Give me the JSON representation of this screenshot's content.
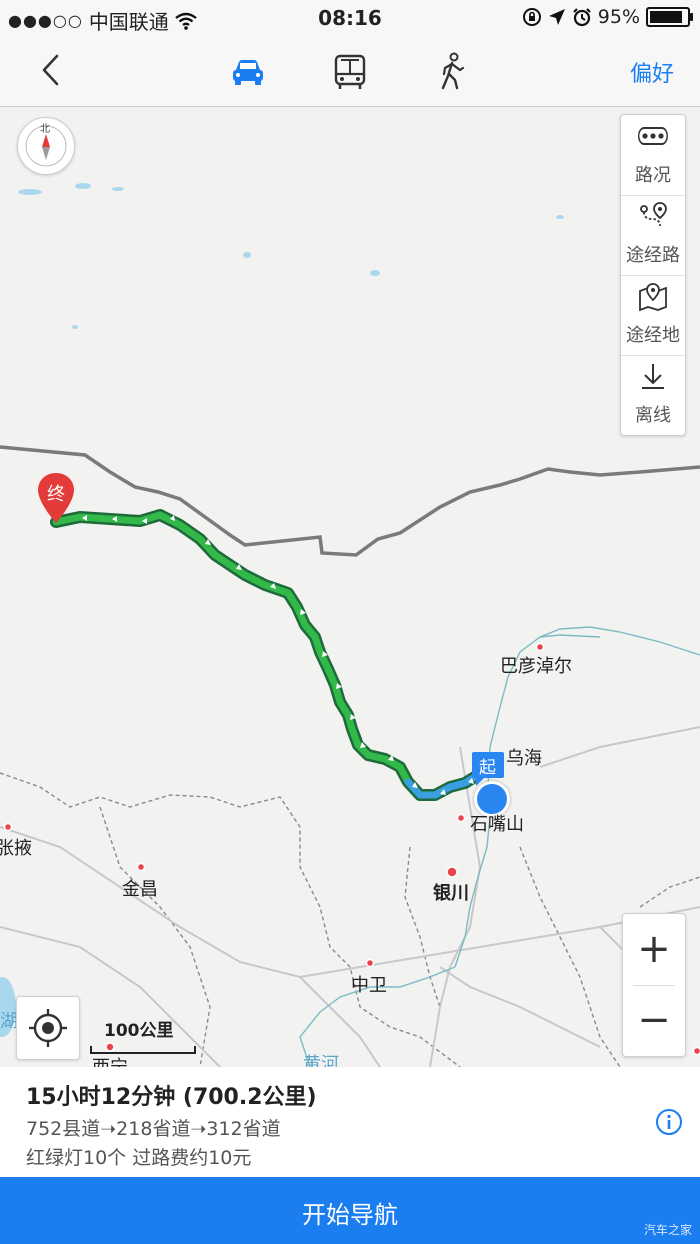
{
  "status": {
    "signal_dots": "●●●○○",
    "carrier": "中国联通",
    "wifi_icon": "wifi-icon",
    "time": "08:16",
    "battery": "95%"
  },
  "nav": {
    "preference_label": "偏好",
    "modes": [
      "car-icon",
      "bus-icon",
      "walk-icon"
    ],
    "active_mode": "car-icon",
    "accent_color": "#1a7df0"
  },
  "map_tools": {
    "traffic": "路况",
    "via_road": "途经路",
    "via_place": "途经地",
    "offline": "离线"
  },
  "compass": {
    "north": "北"
  },
  "markers": {
    "start": "起",
    "end": "终"
  },
  "map_labels": {
    "bayannur": "巴彦淖尔",
    "wuhai": "乌海",
    "shizuishan": "石嘴山",
    "yinchuan": "银川",
    "zhangye": "张掖",
    "jinchang": "金昌",
    "zhongwei": "中卫",
    "xining": "西宁",
    "yellow_river": "黄河",
    "lake": "湖"
  },
  "scale": {
    "label": "100公里"
  },
  "zoom": {
    "in": "+",
    "out": "−"
  },
  "route_info": {
    "duration_distance": "15小时12分钟 (700.2公里)",
    "roads": "752县道➝218省道➝312省道",
    "lights_tolls": "红绿灯10个 过路费约10元"
  },
  "start_button": {
    "label": "开始导航"
  },
  "watermark": "汽车之家"
}
